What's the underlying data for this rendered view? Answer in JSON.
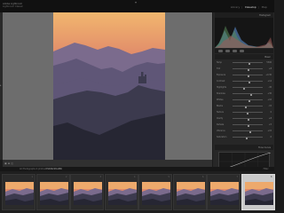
{
  "app": {
    "brand": "Adobe Lightroom",
    "brand_sub": "Lightroom Classic"
  },
  "modules": {
    "items": [
      "Library",
      "Develop",
      "Map"
    ],
    "active": "Develop"
  },
  "right_panel": {
    "histogram_label": "Histogram",
    "basic_label": "Basic",
    "tone_curve_label": "Tone Curve",
    "sliders": [
      {
        "label": "Temp",
        "value": "5300",
        "pos": 0.55
      },
      {
        "label": "Tint",
        "value": "+8",
        "pos": 0.52
      },
      {
        "label": "Exposure",
        "value": "+0.30",
        "pos": 0.54
      },
      {
        "label": "Contrast",
        "value": "+12",
        "pos": 0.56
      },
      {
        "label": "Highlights",
        "value": "-45",
        "pos": 0.38
      },
      {
        "label": "Shadows",
        "value": "+30",
        "pos": 0.62
      },
      {
        "label": "Whites",
        "value": "+10",
        "pos": 0.55
      },
      {
        "label": "Blacks",
        "value": "-15",
        "pos": 0.45
      },
      {
        "label": "Texture",
        "value": "0",
        "pos": 0.5
      },
      {
        "label": "Clarity",
        "value": "+8",
        "pos": 0.54
      },
      {
        "label": "Dehaze",
        "value": "+5",
        "pos": 0.52
      },
      {
        "label": "Vibrance",
        "value": "+15",
        "pos": 0.58
      },
      {
        "label": "Saturation",
        "value": "-5",
        "pos": 0.48
      }
    ]
  },
  "toolbar": {
    "icons": "▣  ⊞  ◫"
  },
  "filmstrip": {
    "info_prefix": "All Photographs",
    "info_count": "9 photos",
    "info_file": "DSC04218.ARW",
    "filter_label": "Filter:",
    "selected_index": 7,
    "count": 8
  },
  "colors": {
    "sky_top": "#f2b66e",
    "sky_mid": "#e08a6a",
    "sky_low": "#8c6e8c",
    "hills_far": "#7b6b8d",
    "hills_mid": "#5f5677",
    "hills_near": "#3c3a4e",
    "hills_dark": "#262633"
  }
}
